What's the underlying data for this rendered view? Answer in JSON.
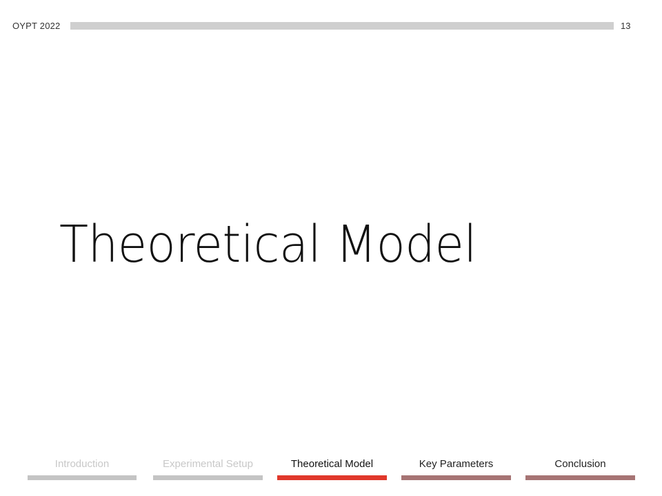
{
  "header": {
    "event_label": "OYPT 2022",
    "page_number": "13"
  },
  "slide": {
    "title": "Theoretical Model"
  },
  "nav": {
    "items": [
      {
        "label": "Introduction",
        "state": "past",
        "color": "#c4c4c4"
      },
      {
        "label": "Experimental Setup",
        "state": "past",
        "color": "#c4c4c4"
      },
      {
        "label": "Theoretical Model",
        "state": "current",
        "color": "#e0382b"
      },
      {
        "label": "Key Parameters",
        "state": "future",
        "color": "#a67474"
      },
      {
        "label": "Conclusion",
        "state": "future",
        "color": "#a67474"
      }
    ]
  },
  "colors": {
    "header_bar": "#cfcfcf",
    "active_section": "#e0382b",
    "upcoming_section": "#a67474",
    "completed_section": "#c4c4c4"
  }
}
